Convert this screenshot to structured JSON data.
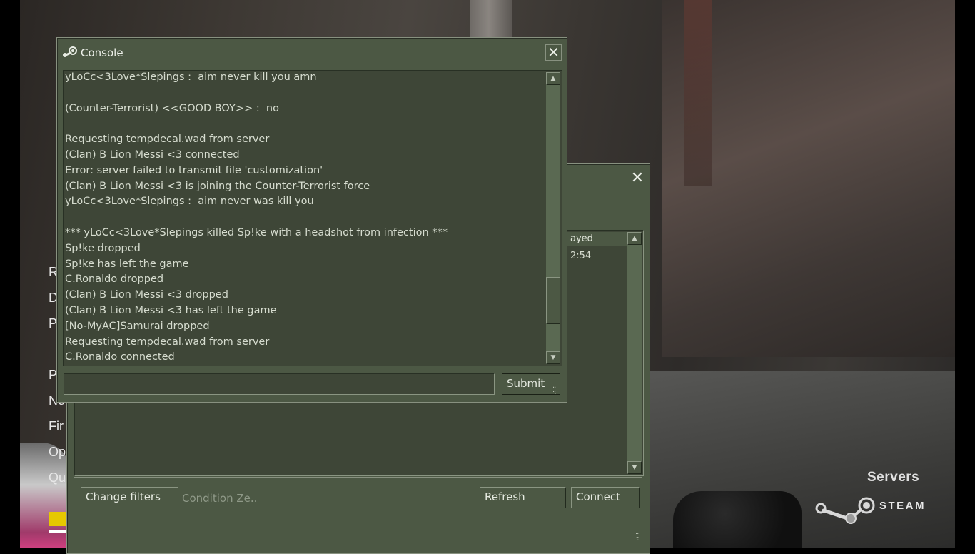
{
  "background": {
    "menu_items": [
      "R",
      "D",
      "P",
      "P",
      "Ne",
      "Fir",
      "Op",
      "Qu"
    ],
    "brand": {
      "servers_label": "Servers",
      "steam_label": "STEAM"
    }
  },
  "server_browser": {
    "column_header": "ayed",
    "row_value": "2:54",
    "change_filters_label": "Change filters",
    "filter_summary": "Condition Ze..",
    "refresh_label": "Refresh",
    "connect_label": "Connect"
  },
  "console": {
    "title": "Console",
    "submit_label": "Submit",
    "input_value": "",
    "lines": [
      "yLoCc<3Love*Slepings :  aim never kill you amn",
      "",
      "(Counter-Terrorist) <<GOOD BOY>> :  no",
      "",
      "Requesting tempdecal.wad from server",
      "(Clan) B Lion Messi <3 connected",
      "Error: server failed to transmit file 'customization'",
      "(Clan) B Lion Messi <3 is joining the Counter-Terrorist force",
      "yLoCc<3Love*Slepings :  aim never was kill you",
      "",
      "*** yLoCc<3Love*Slepings killed Sp!ke with a headshot from infection ***",
      "Sp!ke dropped",
      "Sp!ke has left the game",
      "C.Ronaldo dropped",
      "(Clan) B Lion Messi <3 dropped",
      "(Clan) B Lion Messi <3 has left the game",
      "[No-MyAC]Samurai dropped",
      "Requesting tempdecal.wad from server",
      "C.Ronaldo connected"
    ]
  }
}
